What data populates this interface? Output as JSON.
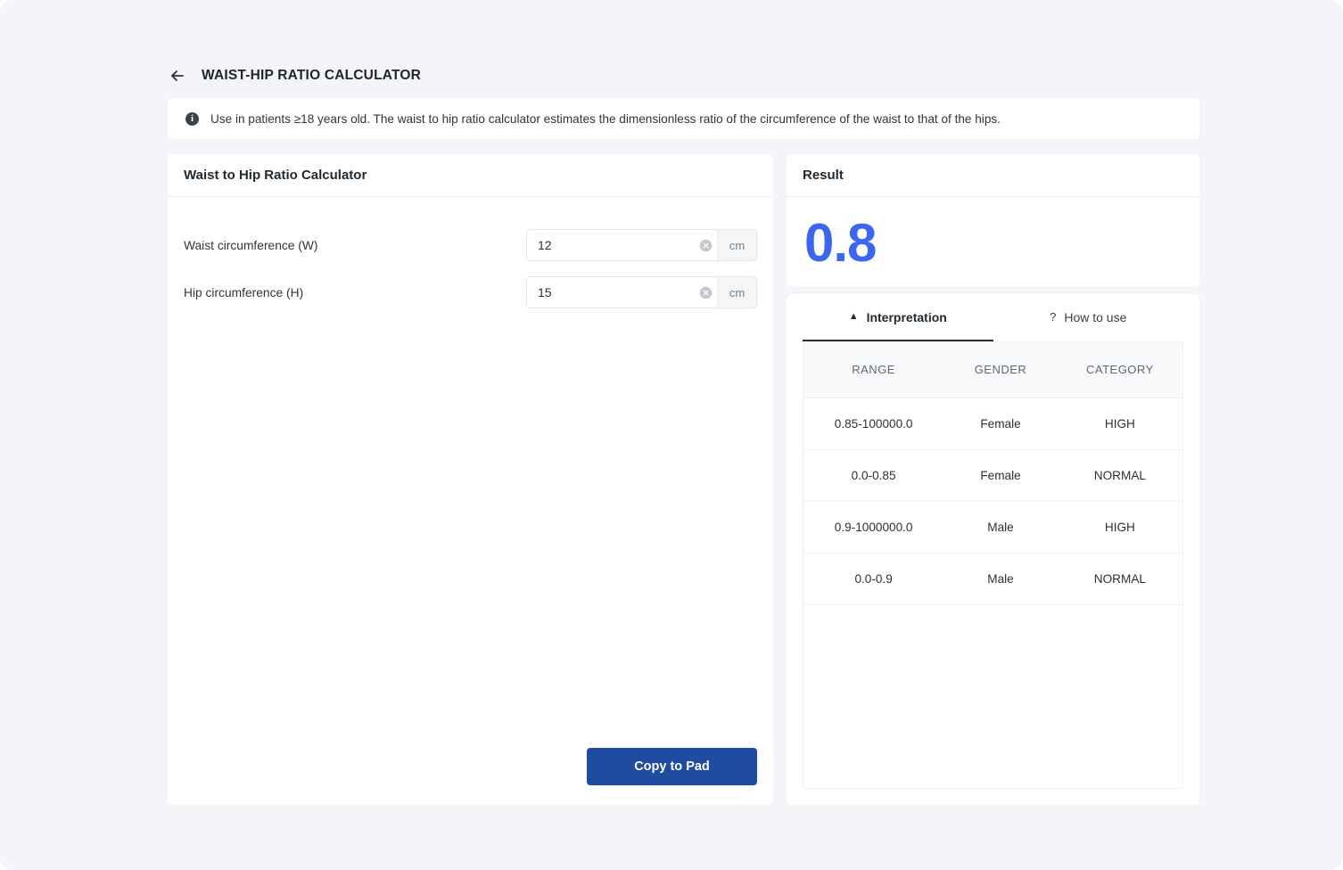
{
  "header": {
    "back_icon": "arrow-left-icon",
    "title": "WAIST-HIP RATIO CALCULATOR"
  },
  "banner": {
    "icon": "info-circle-icon",
    "text": "Use in patients ≥18 years old. The waist to hip ratio calculator estimates the dimensionless ratio of the circumference of the waist to that of the hips."
  },
  "calculator": {
    "title": "Waist to Hip Ratio Calculator",
    "fields": [
      {
        "label": "Waist circumference (W)",
        "value": "12",
        "placeholder": "",
        "unit": "cm",
        "clear_icon": "clear-circle-icon"
      },
      {
        "label": "Hip circumference (H)",
        "value": "15",
        "placeholder": "",
        "unit": "cm",
        "clear_icon": "clear-circle-icon"
      }
    ],
    "copy_button": "Copy to Pad"
  },
  "result": {
    "title": "Result",
    "value": "0.8",
    "accent_color": "#3a66f0"
  },
  "interpretation": {
    "tabs": [
      {
        "label": "Interpretation",
        "icon": "triangle-up-icon",
        "glyph": "▲",
        "active": true
      },
      {
        "label": "How to use",
        "icon": "question-mark-icon",
        "glyph": "?",
        "active": false
      }
    ],
    "table": {
      "columns": [
        "RANGE",
        "GENDER",
        "CATEGORY"
      ],
      "rows": [
        [
          "0.85-100000.0",
          "Female",
          "HIGH"
        ],
        [
          "0.0-0.85",
          "Female",
          "NORMAL"
        ],
        [
          "0.9-1000000.0",
          "Male",
          "HIGH"
        ],
        [
          "0.0-0.9",
          "Male",
          "NORMAL"
        ]
      ]
    }
  },
  "theme": {
    "page_background": "#f4f5f9",
    "card_background": "#ffffff",
    "primary_button": "#1f4ba0"
  }
}
